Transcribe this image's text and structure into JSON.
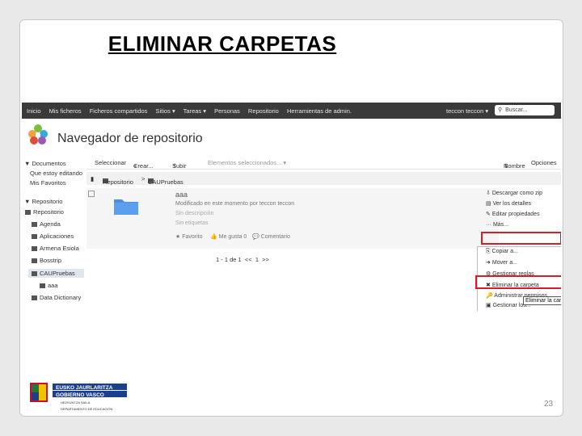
{
  "slide": {
    "title": "ELIMINAR CARPETAS",
    "page_number": "23"
  },
  "topbar": {
    "nav": [
      "Inicio",
      "Mis ficheros",
      "Ficheros compartidos",
      "Sitios ▾",
      "Tareas ▾",
      "Personas",
      "Repositorio",
      "Herramientas de admin."
    ],
    "user": "teccon teccon ▾",
    "search_placeholder": "Buscar..."
  },
  "app": {
    "title": "Navegador de repositorio"
  },
  "sidebar": {
    "documents_header": "▼ Documentos",
    "documents_items": [
      "Que estoy editando",
      "Mis Favoritos"
    ],
    "repo_header": "▼ Repositorio",
    "repo_items": [
      "Repositorio",
      "Agenda",
      "Aplicaciones",
      "Armena Esiola",
      "Bosstrip",
      "CAUPruebas",
      "aaa",
      "Data Dictionary"
    ]
  },
  "toolbar": {
    "select": "Seleccionar",
    "create": "Crear...",
    "upload": "Subir",
    "selected_items": "Elementos seleccionados... ▾",
    "sort_name": "Nombre",
    "options": "Opciones"
  },
  "breadcrumb": {
    "root": "Repositorio",
    "sep": ">",
    "current": "CAUPruebas"
  },
  "item": {
    "name": "aaa",
    "modified": "Modificado en este momento por teccon teccon",
    "no_description": "Sin descripción",
    "no_tags": "Sin etiquetas",
    "favorite": "Favorito",
    "like": "Me gusta",
    "likes_count": "0",
    "comment": "Comentario"
  },
  "pagination": {
    "text": "1 - 1 de 1",
    "prev": "<<",
    "page": "1",
    "next": ">>"
  },
  "actions": [
    "Descargar como zip",
    "Ver los detalles",
    "Editar propiedades",
    "Más..."
  ],
  "more_menu": [
    "Copiar a...",
    "Mover a...",
    "Gestionar reglas",
    "Eliminar la carpeta",
    "Administrar permisos",
    "Gestionar los..."
  ],
  "tooltip": "Eliminar la carpe",
  "gov_logo": {
    "line1": "EUSKO JAURLARITZA",
    "line2": "GOBIERNO VASCO",
    "line3": "HEZKUNTZA SAILA",
    "line4": "DEPARTAMENTO DE EDUCACIÓN"
  },
  "colors": {
    "highlight_box": "#d0202a",
    "topbar": "#3a3a3a",
    "folder": "#4a90e2"
  }
}
